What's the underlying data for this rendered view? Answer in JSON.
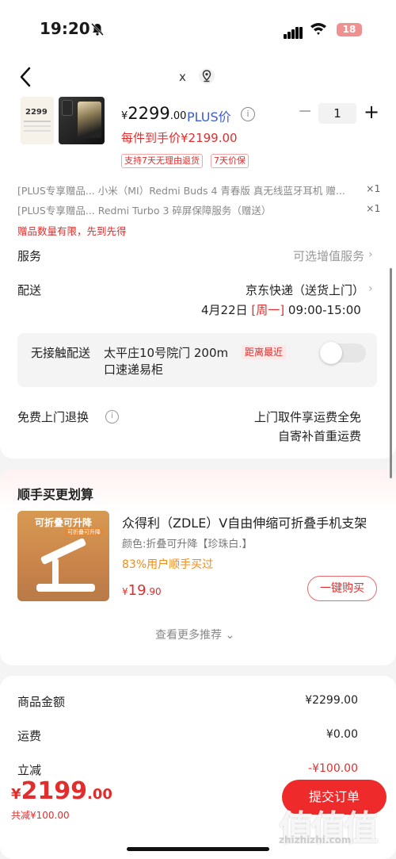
{
  "status_bar": {
    "time": "19:20",
    "battery": "18"
  },
  "header": {
    "x_label": "x"
  },
  "product": {
    "thumb_price": "2299",
    "price_yen": "¥",
    "price_int": "2299",
    "price_dec": ".00",
    "plus_label": "PLUS价",
    "info": "i",
    "quantity": "1",
    "minus": "−",
    "plus": "+",
    "hand_price": "每件到手价¥2199.00",
    "tags": [
      "支持7天无理由退货",
      "7天价保"
    ]
  },
  "gifts": [
    {
      "text": "[PLUS专享赠品...  小米（MI）Redmi Buds 4 青春版 真无线蓝牙耳机 赠...",
      "qty": "×1"
    },
    {
      "text": "[PLUS专享赠品...  Redmi Turbo 3 碎屏保障服务（赠送）",
      "qty": "×1"
    }
  ],
  "gift_notice": "赠品数量有限，先到先得",
  "service": {
    "label": "服务",
    "value": "可选增值服务"
  },
  "delivery": {
    "label": "配送",
    "method": "京东快递（送货上门）",
    "date": "4月22日",
    "weekday": "[周一]",
    "time": "09:00-15:00"
  },
  "contactless": {
    "label": "无接触配送",
    "address_line1": "太平庄10号院门 200m",
    "address_line2": "口速递易柜",
    "badge": "距离最近",
    "enabled": false
  },
  "return": {
    "label": "免费上门退换",
    "line1": "上门取件享运费全免",
    "line2": "自寄补首重运费"
  },
  "recommend": {
    "title": "顺手买更划算",
    "image_banner": "可折叠可升降",
    "image_sub": "可折叠可升降",
    "name": "众得利（ZDLE）V自由伸缩可折叠手机支架",
    "spec": "颜色:折叠可升降【珍珠白.】",
    "rate": "83%用户顺手买过",
    "price_yen": "¥",
    "price_int": "19",
    "price_dec": ".90",
    "buy_label": "一键购买",
    "more_label": "查看更多推荐 ⌄"
  },
  "summary": {
    "rows": [
      {
        "label": "商品金额",
        "value": "¥2299.00"
      },
      {
        "label": "运费",
        "value": "¥0.00"
      },
      {
        "label": "立减",
        "value": "-¥100.00"
      }
    ],
    "total_yen": "¥",
    "total_int": "2199",
    "total_dec": ".00",
    "saved": "共减¥100.00",
    "submit_label": "提交订单"
  },
  "watermark": {
    "text": "值值值",
    "url": "zhizhizhi.com"
  },
  "colors": {
    "accent_red": "#e22d2d",
    "plus_blue": "#3b5bd9",
    "orange": "#f28b1b"
  }
}
